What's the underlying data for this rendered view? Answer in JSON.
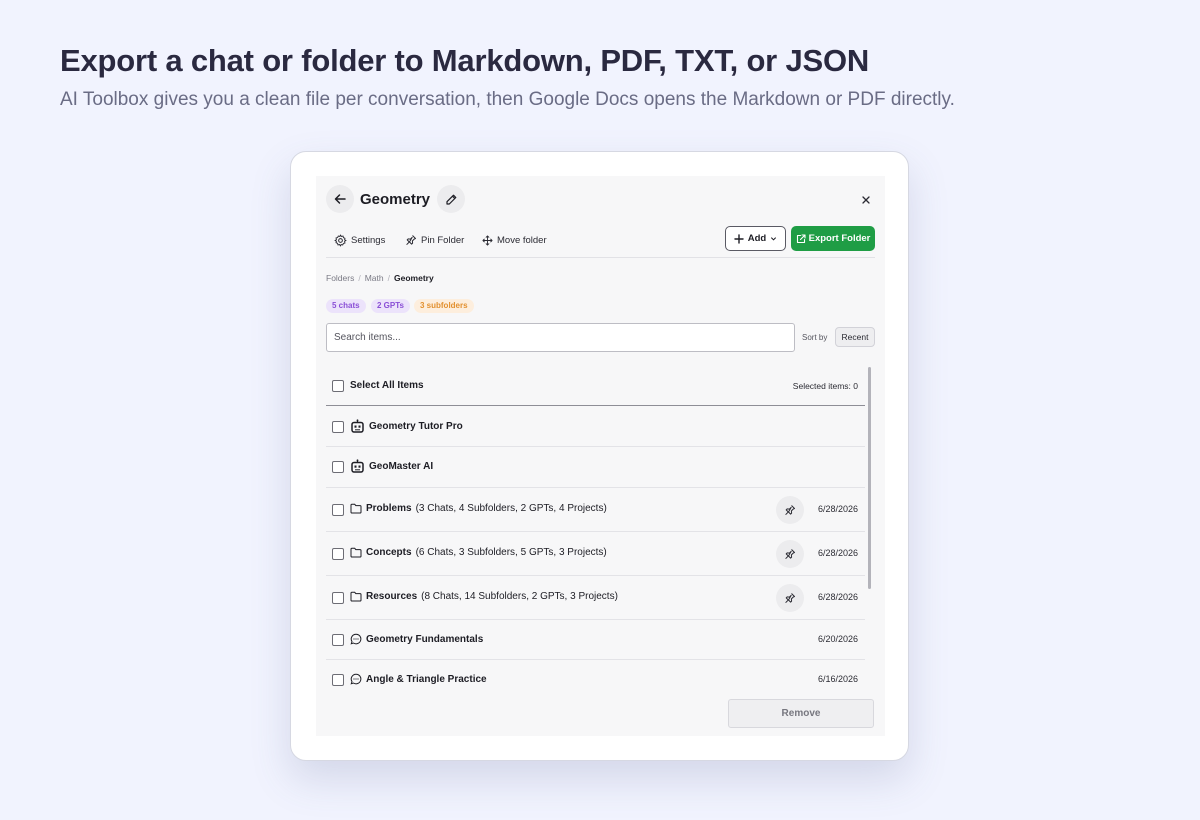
{
  "hero": {
    "title": "Export a chat or folder to Markdown, PDF, TXT, or JSON",
    "subtitle": "AI Toolbox gives you a clean file per conversation, then Google Docs opens the Markdown or PDF directly."
  },
  "panel": {
    "title": "Geometry",
    "toolbar": {
      "settings": "Settings",
      "pin_folder": "Pin Folder",
      "move_folder": "Move folder",
      "add": "Add",
      "export_folder": "Export Folder"
    },
    "breadcrumb": [
      "Folders",
      "Math",
      "Geometry"
    ],
    "badges": {
      "chats": "5 chats",
      "gpts": "2 GPTs",
      "subfolders": "3 subfolders"
    },
    "search": {
      "placeholder": "Search items..."
    },
    "sort": {
      "label": "Sort by",
      "value": "Recent"
    },
    "list_header": {
      "select_all": "Select All Items",
      "selected": "Selected items: 0"
    },
    "items": [
      {
        "type": "gpt",
        "name": "Geometry Tutor Pro",
        "detail": "",
        "date": ""
      },
      {
        "type": "gpt",
        "name": "GeoMaster AI",
        "detail": "",
        "date": ""
      },
      {
        "type": "folder",
        "name": "Problems",
        "detail": "(3 Chats, 4 Subfolders, 2 GPTs, 4 Projects)",
        "date": "6/28/2026"
      },
      {
        "type": "folder",
        "name": "Concepts",
        "detail": "(6 Chats, 3 Subfolders, 5 GPTs, 3 Projects)",
        "date": "6/28/2026"
      },
      {
        "type": "folder",
        "name": "Resources",
        "detail": "(8 Chats, 14 Subfolders, 2 GPTs, 3 Projects)",
        "date": "6/28/2026"
      },
      {
        "type": "chat",
        "name": "Geometry Fundamentals",
        "detail": "",
        "date": "6/20/2026"
      },
      {
        "type": "chat",
        "name": "Angle & Triangle Practice",
        "detail": "",
        "date": "6/16/2026"
      }
    ],
    "remove": "Remove"
  },
  "colors": {
    "page_bg": "#f1f3fe",
    "accent_green": "#1f9d45",
    "badge_purple_bg": "#ece3fb",
    "badge_purple_text": "#8a4fd6",
    "badge_orange_bg": "#fdeedd",
    "badge_orange_text": "#e2902f"
  }
}
